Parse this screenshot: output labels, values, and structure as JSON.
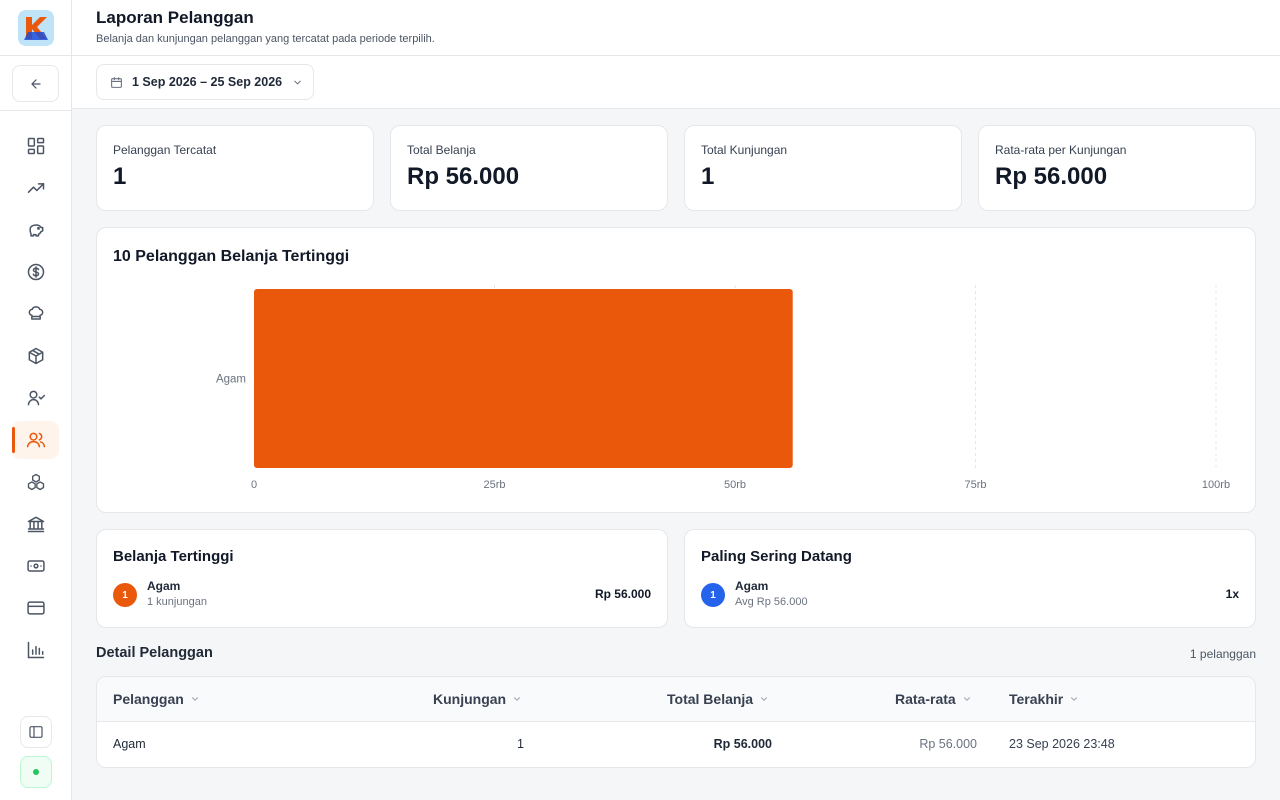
{
  "header": {
    "title": "Laporan Pelanggan",
    "subtitle": "Belanja dan kunjungan pelanggan yang tercatat pada periode terpilih."
  },
  "filter": {
    "date_range": "1 Sep 2026 – 25 Sep 2026"
  },
  "sidebar": {
    "items": [
      {
        "icon": "dashboard-icon"
      },
      {
        "icon": "trending-up-icon"
      },
      {
        "icon": "piggy-bank-icon"
      },
      {
        "icon": "dollar-circle-icon"
      },
      {
        "icon": "chef-hat-icon"
      },
      {
        "icon": "box-icon"
      },
      {
        "icon": "user-check-icon"
      },
      {
        "icon": "users-icon",
        "active": true
      },
      {
        "icon": "boxes-icon"
      },
      {
        "icon": "bank-icon"
      },
      {
        "icon": "banknote-icon"
      },
      {
        "icon": "credit-card-icon"
      },
      {
        "icon": "bar-chart-icon"
      }
    ]
  },
  "stats": [
    {
      "label": "Pelanggan Tercatat",
      "value": "1"
    },
    {
      "label": "Total Belanja",
      "value": "Rp 56.000"
    },
    {
      "label": "Total Kunjungan",
      "value": "1"
    },
    {
      "label": "Rata-rata per Kunjungan",
      "value": "Rp 56.000"
    }
  ],
  "chart_data": {
    "type": "bar",
    "orientation": "horizontal",
    "title": "10 Pelanggan Belanja Tertinggi",
    "categories": [
      "Agam"
    ],
    "values": [
      56000
    ],
    "xlim": [
      0,
      100000
    ],
    "ticks": [
      0,
      25000,
      50000,
      75000,
      100000
    ],
    "tick_labels": [
      "0",
      "25rb",
      "50rb",
      "75rb",
      "100rb"
    ],
    "bar_color": "#ea580c",
    "grid": true
  },
  "top_spending": {
    "title": "Belanja Tertinggi",
    "items": [
      {
        "rank": "1",
        "name": "Agam",
        "sub": "1 kunjungan",
        "value": "Rp 56.000"
      }
    ]
  },
  "most_frequent": {
    "title": "Paling Sering Datang",
    "items": [
      {
        "rank": "1",
        "name": "Agam",
        "sub": "Avg Rp 56.000",
        "value": "1x"
      }
    ]
  },
  "detail": {
    "title": "Detail Pelanggan",
    "count": "1 pelanggan",
    "columns": [
      "Pelanggan",
      "Kunjungan",
      "Total Belanja",
      "Rata-rata",
      "Terakhir"
    ],
    "rows": [
      {
        "customer": "Agam",
        "visits": "1",
        "total": "Rp 56.000",
        "average": "Rp 56.000",
        "last": "23 Sep 2026 23:48"
      }
    ]
  },
  "colors": {
    "accent": "#ea580c",
    "blue": "#2563eb",
    "status": "#22c55e"
  }
}
